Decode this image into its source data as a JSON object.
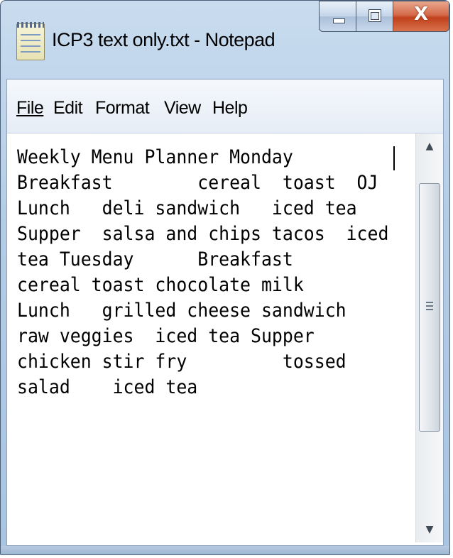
{
  "window": {
    "title": "ICP3 text only.txt - Notepad",
    "close_label": "X"
  },
  "menu": {
    "file": "File",
    "edit": "Edit",
    "format": "Format",
    "view": "View",
    "help": "Help"
  },
  "document": {
    "lines": [
      "Weekly Menu Planner Monday",
      "Breakfast        cereal  toast  OJ",
      "Lunch   deli sandwich   iced tea",
      "Supper  salsa and chips tacos  iced",
      "tea Tuesday      Breakfast",
      "cereal toast chocolate milk",
      "Lunch   grilled cheese sandwich",
      "raw veggies  iced tea Supper",
      "chicken stir fry         tossed",
      "salad    iced tea"
    ]
  },
  "icons": {
    "app": "notepad-icon",
    "minimize": "minimize-icon",
    "maximize": "maximize-icon",
    "close": "close-icon",
    "scroll_up": "arrow-up-icon",
    "scroll_down": "arrow-down-icon",
    "grip": "grip-icon"
  },
  "colors": {
    "titlebar": "#b3cce6",
    "close_button": "#c1411c",
    "editor_background": "#ffffff"
  }
}
